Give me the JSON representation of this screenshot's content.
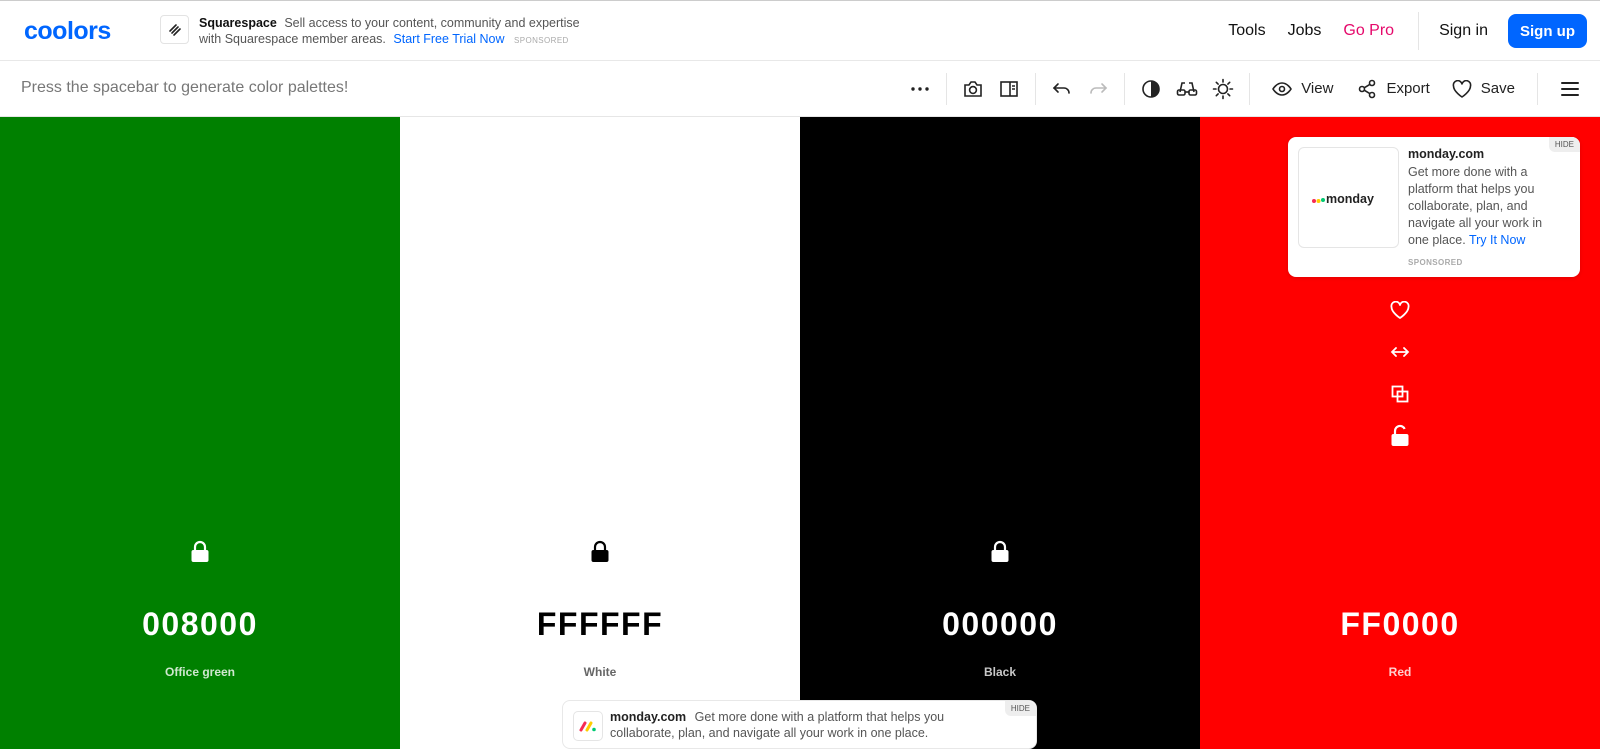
{
  "header": {
    "logo_text": "coolors",
    "ad": {
      "brand": "Squarespace",
      "text": "Sell access to your content, community and expertise with Squarespace member areas.",
      "cta": "Start Free Trial Now",
      "sponsored": "SPONSORED"
    },
    "nav": {
      "tools": "Tools",
      "jobs": "Jobs",
      "go_pro": "Go Pro",
      "sign_in": "Sign in",
      "sign_up": "Sign up"
    }
  },
  "toolbar": {
    "hint": "Press the spacebar to generate color palettes!",
    "view": "View",
    "export": "Export",
    "save": "Save"
  },
  "palette": [
    {
      "hex": "008000",
      "name": "Office green",
      "bg": "#008000",
      "fg": "#ffffff",
      "sub": "#cfe8cf"
    },
    {
      "hex": "FFFFFF",
      "name": "White",
      "bg": "#ffffff",
      "fg": "#000000",
      "sub": "#666666"
    },
    {
      "hex": "000000",
      "name": "Black",
      "bg": "#000000",
      "fg": "#ffffff",
      "sub": "#c8c8c8"
    },
    {
      "hex": "FF0000",
      "name": "Red",
      "bg": "#ff0000",
      "fg": "#ffffff",
      "sub": "#ffd0d0"
    }
  ],
  "ad_card": {
    "title": "monday.com",
    "body": "Get more done with a platform that helps you collaborate, plan, and navigate all your work in one place.",
    "cta": "Try It Now",
    "sponsored": "SPONSORED",
    "hide": "HIDE",
    "logo_text": "monday"
  },
  "ad_bottom": {
    "title": "monday.com",
    "body": "Get more done with a platform that helps you collaborate, plan, and navigate all your work in one place.",
    "hide": "HIDE"
  }
}
